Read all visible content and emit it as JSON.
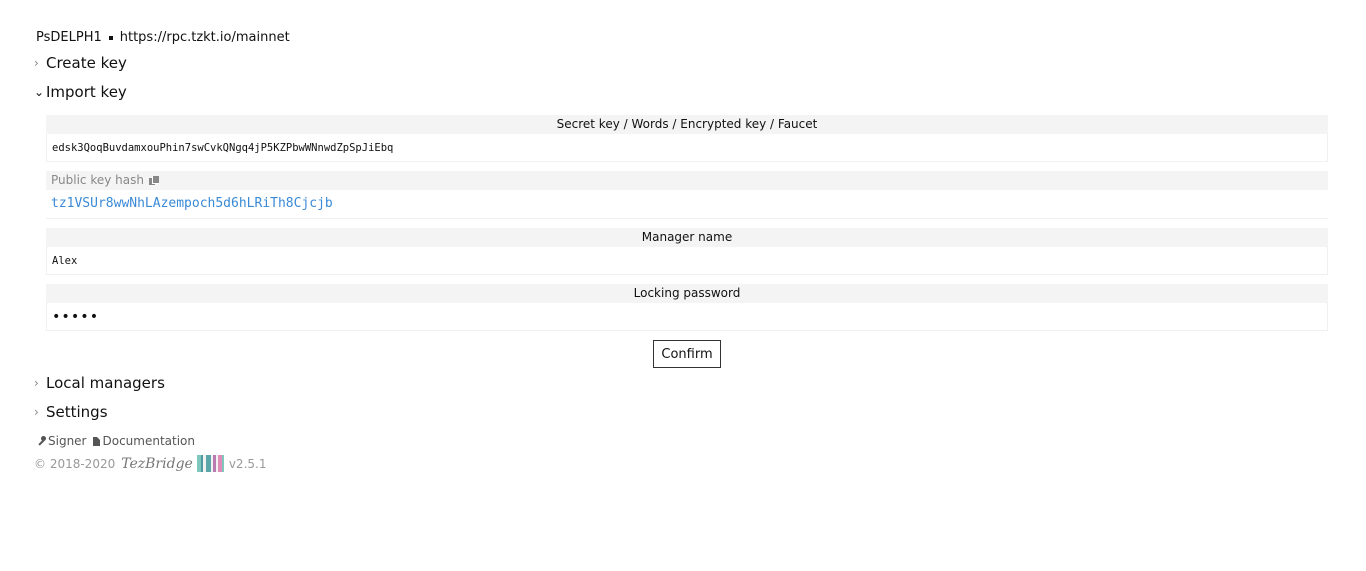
{
  "network": {
    "protocol": "PsDELPH1",
    "rpc_url": "https://rpc.tzkt.io/mainnet"
  },
  "sections": {
    "create_key": "Create key",
    "import_key": "Import key",
    "local_managers": "Local managers",
    "settings": "Settings"
  },
  "import_form": {
    "secret_key_label": "Secret key / Words / Encrypted key / Faucet",
    "secret_key_value": "edsk3QoqBuvdamxouPhin7swCvkQNgq4jP5KZPbwWNnwdZpSpJiEbq",
    "public_key_hash_label": "Public key hash",
    "public_key_hash_value": "tz1VSUr8wwNhLAzempoch5d6hLRiTh8Cjcjb",
    "manager_name_label": "Manager name",
    "manager_name_value": "Alex",
    "locking_password_label": "Locking password",
    "locking_password_value": "•••••",
    "confirm_label": "Confirm"
  },
  "footer": {
    "signer_link": "Signer",
    "documentation_link": "Documentation",
    "copyright": "© 2018-2020",
    "brand": "TezBridge",
    "version": "v2.5.1"
  },
  "icons": {
    "collapsed": "chevron-right-icon",
    "expanded": "chevron-down-icon",
    "copy": "copy-icon",
    "signer": "key-icon",
    "documentation": "file-icon"
  },
  "colors": {
    "pkh_link": "#3a8ad6",
    "label_bg": "#f4f4f4",
    "logo_stripes": [
      "#7ec8c0",
      "#4e9aa0",
      "#f2f2f2",
      "#b77bb0",
      "#e08ab8",
      "#5aa6a8"
    ]
  }
}
